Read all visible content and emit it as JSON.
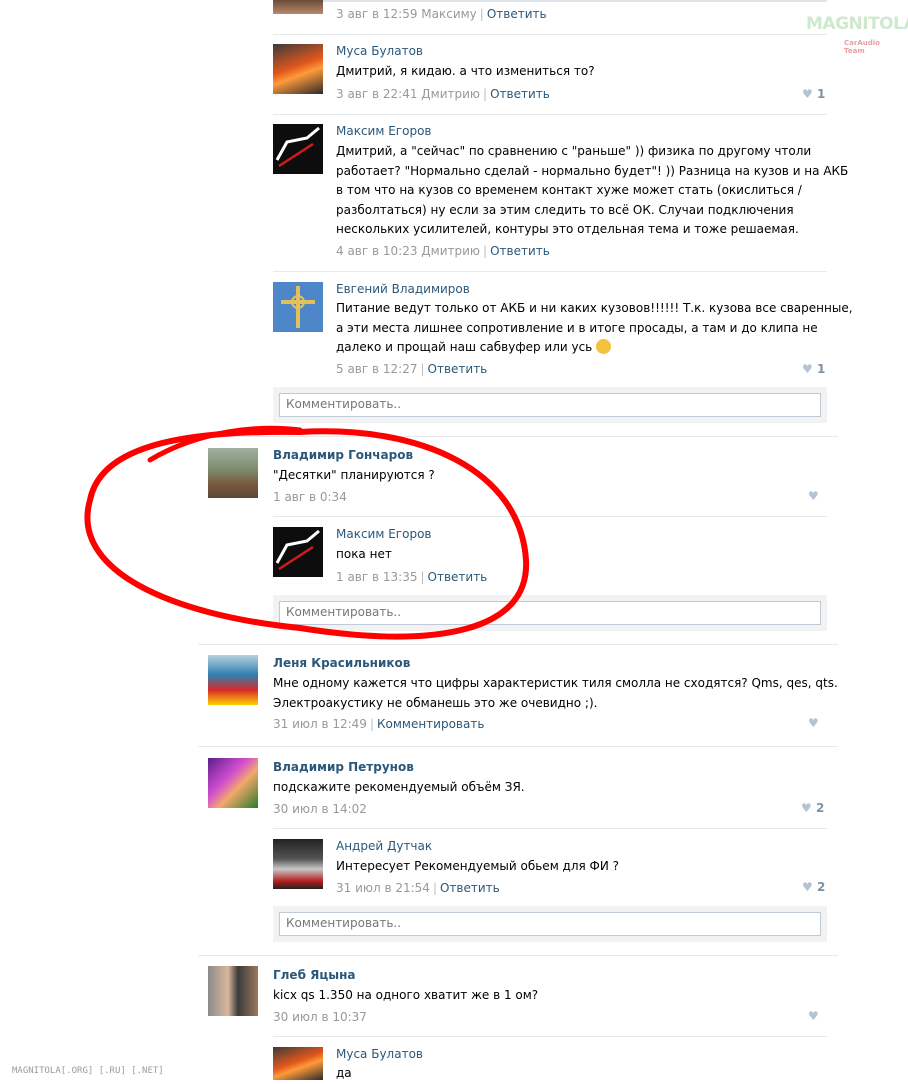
{
  "watermark": {
    "logo": "MAGNITOLA",
    "logo_sub": "CarAudio Team",
    "footer": "MAGNITOLA[.ORG] [.RU] [.NET]"
  },
  "reply_link": "Ответить",
  "comment_link": "Комментировать",
  "comment_placeholder": "Комментировать..",
  "posts": [
    {
      "meta": "3 авг в 12:59 Максиму"
    },
    {
      "author": "Муса Булатов",
      "text": [
        "Дмитрий, я кидаю. а что измениться то?"
      ],
      "meta": "3 авг в 22:41 Дмитрию",
      "likes": "1"
    },
    {
      "author": "Максим Егоров",
      "text": [
        "Дмитрий, а \"сейчас\" по сравнению с \"раньше\" )) физика по другому чтоли",
        "работает? \"Нормально сделай - нормально будет\"! )) Разница на кузов и на АКБ",
        "в том что на кузов со временем контакт хуже может стать (окислиться /",
        "разболтаться) ну если за этим следить то всё ОК. Случаи подключения",
        "нескольких усилителей, контуры это отдельная тема и тоже решаемая."
      ],
      "meta": "4 авг в 10:23 Дмитрию"
    },
    {
      "author": "Евгений Владимиров",
      "text": [
        "Питание ведут только от АКБ и ни каких кузовов!!!!!! Т.к. кузова все сваренные,",
        "а эти места лишнее сопротивление и в итоге просады, а там и до клипа не",
        "далеко и прощай наш сабвуфер или усь"
      ],
      "meta": "5 авг в 12:27",
      "likes": "1"
    },
    {
      "author": "Владимир Гончаров",
      "text": [
        "\"Десятки\" планируются ?"
      ],
      "meta": "1 авг в 0:34"
    },
    {
      "author": "Максим Егоров",
      "text": [
        "пока нет"
      ],
      "meta": "1 авг в 13:35"
    },
    {
      "author": "Леня Красильников",
      "text": [
        "Мне одному кажется что цифры характеристик тиля смолла не сходятся? Qms, qes, qts.",
        "Электроакустику не обманешь это же очевидно ;)."
      ],
      "meta": "31 июл в 12:49"
    },
    {
      "author": "Владимир Петрунов",
      "text": [
        "подскажите рекомендуемый объём ЗЯ."
      ],
      "meta": "30 июл в 14:02",
      "likes": "2"
    },
    {
      "author": "Андрей Дутчак",
      "text": [
        "Интересует Рекомендуемый обьем для ФИ ?"
      ],
      "meta": "31 июл в 21:54",
      "likes": "2"
    },
    {
      "author": "Глеб Яцына",
      "text": [
        "kicx qs 1.350 на одного хватит же в 1 ом?"
      ],
      "meta": "30 июл в 10:37"
    },
    {
      "author": "Муса Булатов",
      "text": [
        "да"
      ]
    }
  ],
  "colors": {
    "link": "#2b587a",
    "meta": "#999999",
    "like": "#b4c4d4",
    "circle": "#ff0000"
  }
}
